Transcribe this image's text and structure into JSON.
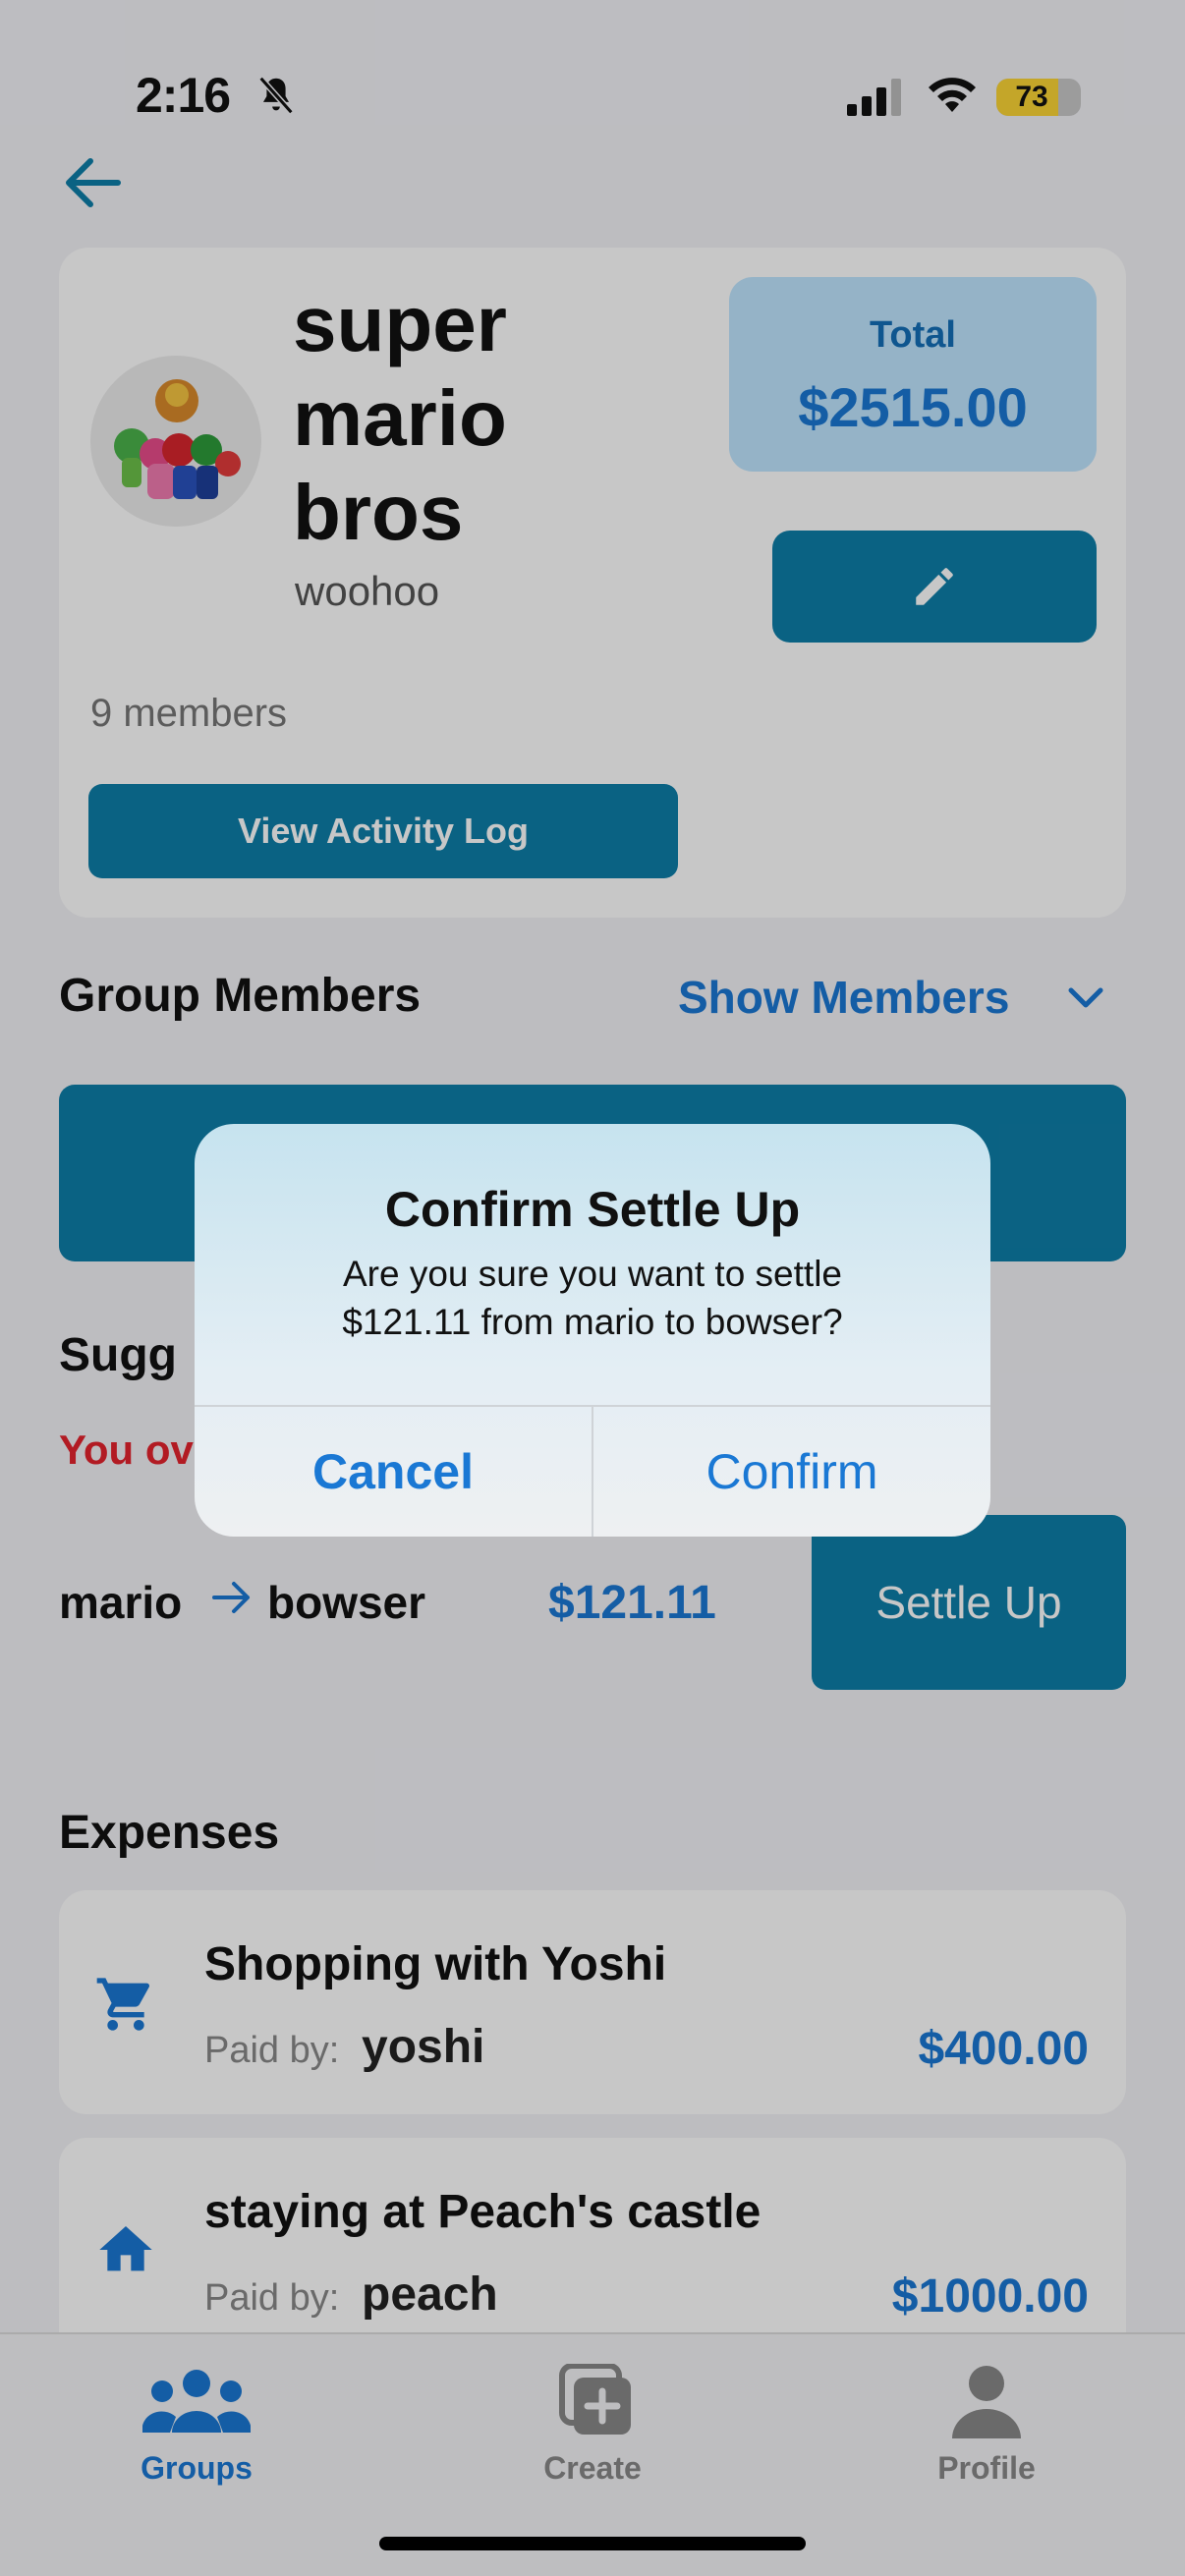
{
  "status_bar": {
    "time": "2:16",
    "battery": "73",
    "battery_level": 0.73
  },
  "group": {
    "name": "super mario bros",
    "description": "woohoo",
    "members_count": "9 members",
    "total_label": "Total",
    "total_value": "$2515.00",
    "activity_button": "View Activity Log"
  },
  "members_section": {
    "title": "Group Members",
    "toggle": "Show Members"
  },
  "suggested": {
    "title": "Sugg",
    "you_owe": "You ov",
    "from": "mario",
    "to": "bowser",
    "amount": "$121.11",
    "button": "Settle Up"
  },
  "expenses": {
    "title": "Expenses",
    "paid_by_label": "Paid by:",
    "items": [
      {
        "name": "Shopping with Yoshi",
        "payer": "yoshi",
        "amount": "$400.00",
        "icon": "cart-icon"
      },
      {
        "name": "staying at Peach's castle",
        "payer": "peach",
        "amount": "$1000.00",
        "icon": "home-icon"
      }
    ]
  },
  "tabs": [
    {
      "label": "Groups",
      "icon": "groups-icon",
      "active": true
    },
    {
      "label": "Create",
      "icon": "create-icon",
      "active": false
    },
    {
      "label": "Profile",
      "icon": "profile-icon",
      "active": false
    }
  ],
  "dialog": {
    "title": "Confirm Settle Up",
    "message_line1": "Are you sure you want to settle",
    "message_line2": "$121.11 from mario to bowser?",
    "cancel": "Cancel",
    "confirm": "Confirm"
  },
  "colors": {
    "accent": "#0e7ea8",
    "link": "#1a78d4",
    "danger": "#e5232e"
  }
}
